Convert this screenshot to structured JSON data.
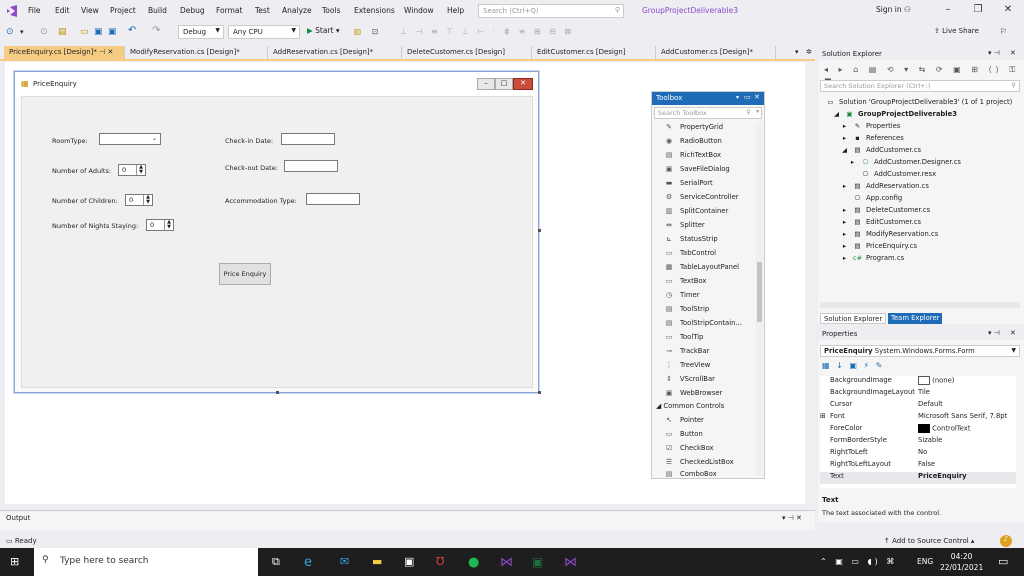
{
  "menu": {
    "items": [
      "File",
      "Edit",
      "View",
      "Project",
      "Build",
      "Debug",
      "Format",
      "Test",
      "Analyze",
      "Tools",
      "Extensions",
      "Window",
      "Help"
    ],
    "search_placeholder": "Search (Ctrl+Q)",
    "project_name": "GroupProjectDeliverable3",
    "sign_in": "Sign in"
  },
  "toolbar": {
    "config": "Debug",
    "platform": "Any CPU",
    "start": "Start",
    "live_share": "Live Share"
  },
  "tabs": [
    {
      "label": "PriceEnquiry.cs [Design]*",
      "active": true
    },
    {
      "label": "ModifyReservation.cs [Design]*"
    },
    {
      "label": "AddReservation.cs [Design]*"
    },
    {
      "label": "DeleteCustomer.cs [Design]"
    },
    {
      "label": "EditCustomer.cs [Design]"
    },
    {
      "label": "AddCustomer.cs [Design]*"
    }
  ],
  "form": {
    "title": "PriceEnquiry",
    "labels": {
      "room_type": "RoomType:",
      "adults": "Number of Adults:",
      "children": "Number of Children:",
      "nights": "Number of Nights Staying:",
      "check_in": "Check-in Date:",
      "check_out": "Check-out Date:",
      "accommodation": "Accommodation Type:"
    },
    "values": {
      "adults": "0",
      "children": "0",
      "nights": "0"
    },
    "button": "Price Enquiry"
  },
  "toolbox": {
    "title": "Toolbox",
    "search_placeholder": "Search Toolbox",
    "items": [
      "PropertyGrid",
      "RadioButton",
      "RichTextBox",
      "SaveFileDialog",
      "SerialPort",
      "ServiceController",
      "SplitContainer",
      "Splitter",
      "StatusStrip",
      "TabControl",
      "TableLayoutPanel",
      "TextBox",
      "Timer",
      "ToolStrip",
      "ToolStripContain...",
      "ToolTip",
      "TrackBar",
      "TreeView",
      "VScrollBar",
      "WebBrowser"
    ],
    "group": "Common Controls",
    "common_items": [
      "Pointer",
      "Button",
      "CheckBox",
      "CheckedListBox",
      "ComboBox"
    ]
  },
  "solution_explorer": {
    "title": "Solution Explorer",
    "search_placeholder": "Search Solution Explorer (Ctrl+;)",
    "solution": "Solution 'GroupProjectDeliverable3' (1 of 1 project)",
    "project": "GroupProjectDeliverable3",
    "items": [
      {
        "label": "Properties",
        "indent": 2
      },
      {
        "label": "References",
        "indent": 2
      },
      {
        "label": "AddCustomer.cs",
        "indent": 2
      },
      {
        "label": "AddCustomer.Designer.cs",
        "indent": 3
      },
      {
        "label": "AddCustomer.resx",
        "indent": 3
      },
      {
        "label": "AddReservation.cs",
        "indent": 2
      },
      {
        "label": "App.config",
        "indent": 2
      },
      {
        "label": "DeleteCustomer.cs",
        "indent": 2
      },
      {
        "label": "EditCustomer.cs",
        "indent": 2
      },
      {
        "label": "ModifyReservation.cs",
        "indent": 2
      },
      {
        "label": "PriceEnquiry.cs",
        "indent": 2
      },
      {
        "label": "Program.cs",
        "indent": 2
      }
    ],
    "tab_solution": "Solution Explorer",
    "tab_team": "Team Explorer"
  },
  "properties": {
    "title": "Properties",
    "object": "PriceEnquiry",
    "object_type": "System.Windows.Forms.Form",
    "rows": [
      {
        "name": "BackgroundImage",
        "value": "(none)"
      },
      {
        "name": "BackgroundImageLayout",
        "value": "Tile"
      },
      {
        "name": "Cursor",
        "value": "Default"
      },
      {
        "name": "Font",
        "value": "Microsoft Sans Serif, 7.8pt"
      },
      {
        "name": "ForeColor",
        "value": "ControlText"
      },
      {
        "name": "FormBorderStyle",
        "value": "Sizable"
      },
      {
        "name": "RightToLeft",
        "value": "No"
      },
      {
        "name": "RightToLeftLayout",
        "value": "False"
      },
      {
        "name": "Text",
        "value": "PriceEnquiry"
      }
    ],
    "desc_title": "Text",
    "desc": "The text associated with the control."
  },
  "output": {
    "title": "Output"
  },
  "status": {
    "ready": "Ready",
    "source_control": "Add to Source Control"
  },
  "taskbar": {
    "search": "Type here to search",
    "lang": "ENG",
    "time": "04:20",
    "date": "22/01/2021"
  }
}
